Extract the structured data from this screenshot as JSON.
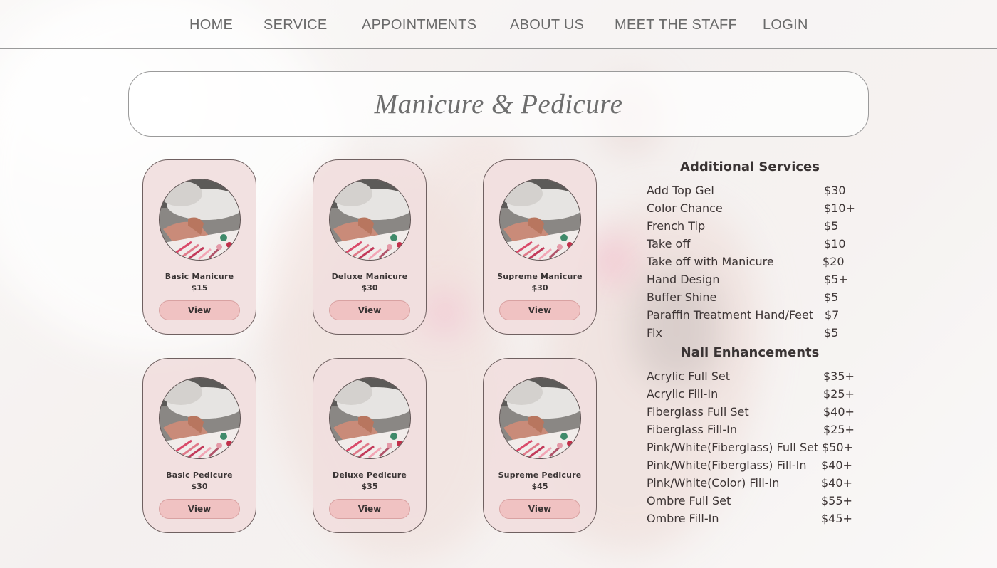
{
  "nav": {
    "items": [
      "HOME",
      "SERVICE",
      "APPOINTMENTS",
      "ABOUT US",
      "MEET THE STAFF",
      "LOGIN"
    ]
  },
  "page_title": "Manicure & Pedicure",
  "cards": [
    {
      "name": "Basic Manicure",
      "price": "$15",
      "button": "View"
    },
    {
      "name": "Deluxe Manicure",
      "price": "$30",
      "button": "View"
    },
    {
      "name": "Supreme Manicure",
      "price": "$30",
      "button": "View"
    },
    {
      "name": "Basic Pedicure",
      "price": "$30",
      "button": "View"
    },
    {
      "name": "Deluxe Pedicure",
      "price": "$35",
      "button": "View"
    },
    {
      "name": "Supreme Pedicure",
      "price": "$45",
      "button": "View"
    }
  ],
  "additional_services": {
    "heading": "Additional Services",
    "items": [
      {
        "name": "Add Top Gel",
        "price": "$30"
      },
      {
        "name": "Color Chance",
        "price": "$10+"
      },
      {
        "name": "French Tip",
        "price": "$5"
      },
      {
        "name": "Take off",
        "price": "$10"
      },
      {
        "name": "Take off with Manicure",
        "price": "$20"
      },
      {
        "name": "Hand Design",
        "price": "$5+"
      },
      {
        "name": "Buffer Shine",
        "price": "$5"
      },
      {
        "name": "Paraffin Treatment Hand/Feet",
        "price": "$7"
      },
      {
        "name": "Fix",
        "price": "$5"
      }
    ]
  },
  "nail_enhancements": {
    "heading": "Nail Enhancements",
    "items": [
      {
        "name": "Acrylic Full Set",
        "price": "$35+"
      },
      {
        "name": "Acrylic Fill-In",
        "price": "$25+"
      },
      {
        "name": "Fiberglass Full Set",
        "price": "$40+"
      },
      {
        "name": "Fiberglass Fill-In",
        "price": "$25+"
      },
      {
        "name": "Pink/White(Fiberglass) Full Set",
        "price": "$50+"
      },
      {
        "name": "Pink/White(Fiberglass) Fill-In",
        "price": "$40+"
      },
      {
        "name": "Pink/White(Color) Fill-In",
        "price": "$40+"
      },
      {
        "name": "Ombre Full Set",
        "price": "$55+"
      },
      {
        "name": "Ombre Fill-In",
        "price": "$45+"
      }
    ]
  },
  "colors": {
    "card_bg": "#f1dfdf",
    "button_bg": "#f0c2c2",
    "text_dark": "#3a3434",
    "nav_text": "#6a6a6a"
  }
}
